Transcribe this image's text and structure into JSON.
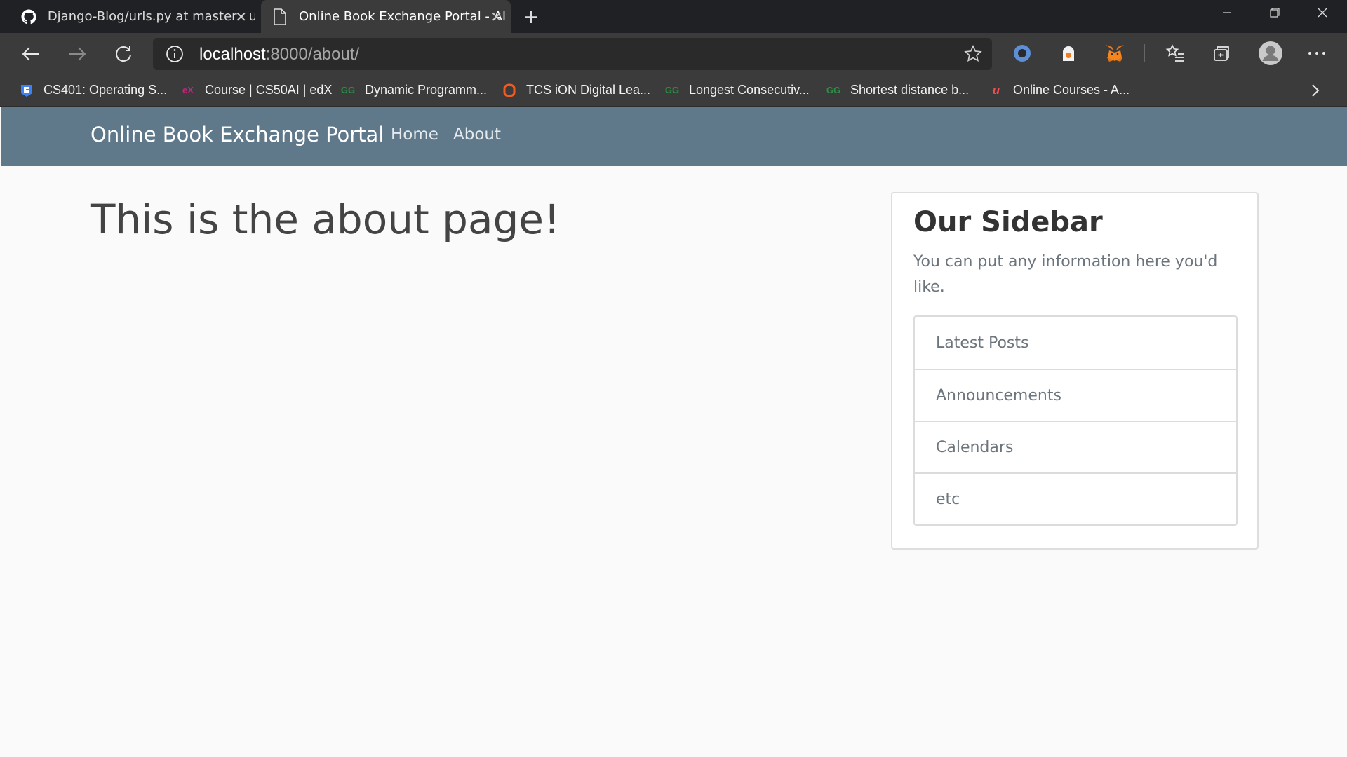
{
  "browser": {
    "tabs": [
      {
        "title": "Django-Blog/urls.py at master · u",
        "icon": "github-icon",
        "active": false
      },
      {
        "title": "Online Book Exchange Portal - Al",
        "icon": "document-icon",
        "active": true
      }
    ],
    "url_host": "localhost",
    "url_rest": ":8000/about/",
    "bookmarks": [
      {
        "label": "CS401: Operating S...",
        "icon": "saylor-icon",
        "color": "#3b82f6"
      },
      {
        "label": "Course | CS50AI | edX",
        "icon": "edx-icon",
        "color": "#c0267a"
      },
      {
        "label": "Dynamic Programm...",
        "icon": "gfg-icon",
        "color": "#2f8d46"
      },
      {
        "label": "TCS iON Digital Lea...",
        "icon": "tcs-icon",
        "color": "#ef5b25"
      },
      {
        "label": "Longest Consecutiv...",
        "icon": "gfg-icon",
        "color": "#2f8d46"
      },
      {
        "label": "Shortest distance b...",
        "icon": "gfg-icon",
        "color": "#2f8d46"
      },
      {
        "label": "Online Courses - A...",
        "icon": "udemy-icon",
        "color": "#ec5252"
      }
    ]
  },
  "site": {
    "brand": "Online Book Exchange Portal",
    "nav": [
      {
        "label": "Home"
      },
      {
        "label": "About"
      }
    ]
  },
  "main": {
    "heading": "This is the about page!"
  },
  "sidebar": {
    "title": "Our Sidebar",
    "text": "You can put any information here you'd like.",
    "items": [
      {
        "label": "Latest Posts"
      },
      {
        "label": "Announcements"
      },
      {
        "label": "Calendars"
      },
      {
        "label": "etc"
      }
    ]
  },
  "colors": {
    "navbar": "#5f788a",
    "page_bg": "#fafafa",
    "browser_frame": "#3b3b3b"
  }
}
